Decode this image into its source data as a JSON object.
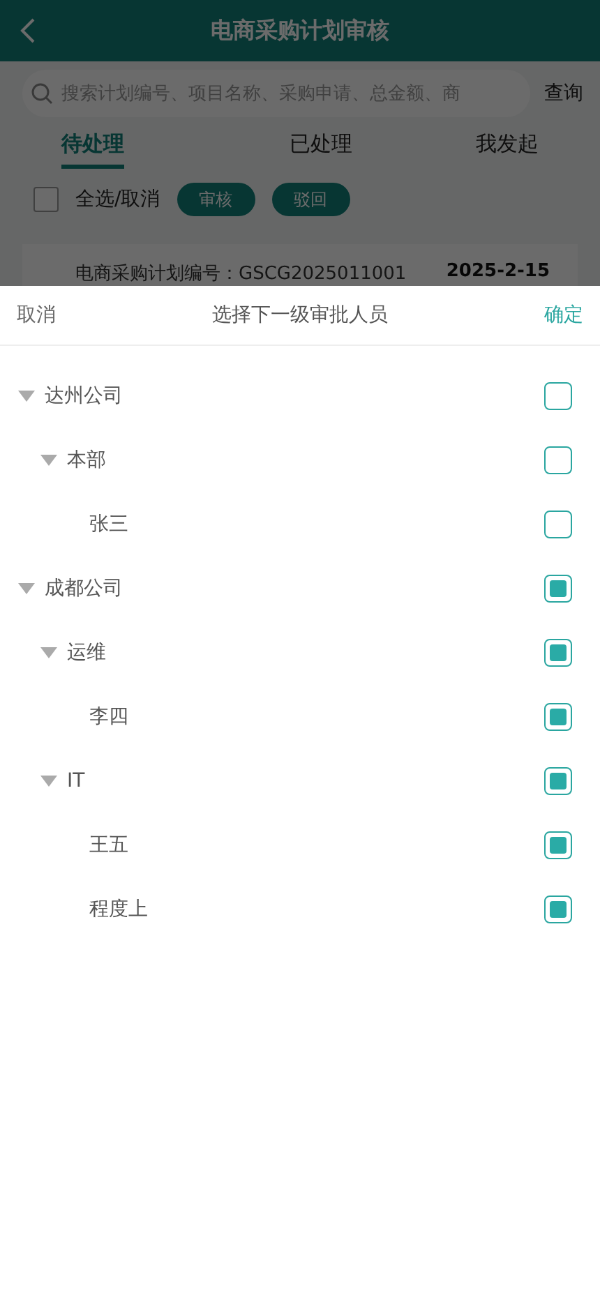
{
  "page": {
    "title": "电商采购计划审核",
    "search": {
      "placeholder": "搜索计划编号、项目名称、采购申请、总金额、商"
    },
    "search_button": "查询",
    "tabs": [
      {
        "label": "待处理",
        "selected": true
      },
      {
        "label": "已处理",
        "selected": false
      },
      {
        "label": "我发起",
        "selected": false
      }
    ],
    "select_all": {
      "label": "全选/取消",
      "checked": false
    },
    "actions": [
      "审核",
      "驳回"
    ],
    "record": {
      "plan_no": "电商采购计划编号：GSCG2025011001",
      "date": "2025-2-15"
    }
  },
  "sheet": {
    "cancel": "取消",
    "title": "选择下一级审批人员",
    "confirm": "确定",
    "tree": [
      {
        "label": "达州公司",
        "expanded": true,
        "checked": false,
        "children": [
          {
            "label": "本部",
            "expanded": true,
            "checked": false,
            "children": [
              {
                "label": "张三",
                "checked": false
              }
            ]
          }
        ]
      },
      {
        "label": "成都公司",
        "expanded": true,
        "checked": true,
        "children": [
          {
            "label": "运维",
            "expanded": true,
            "checked": true,
            "children": [
              {
                "label": "李四",
                "checked": true
              }
            ]
          },
          {
            "label": "IT",
            "expanded": true,
            "checked": true,
            "children": [
              {
                "label": "王五",
                "checked": true
              },
              {
                "label": "程度上",
                "checked": true
              }
            ]
          }
        ]
      }
    ]
  }
}
